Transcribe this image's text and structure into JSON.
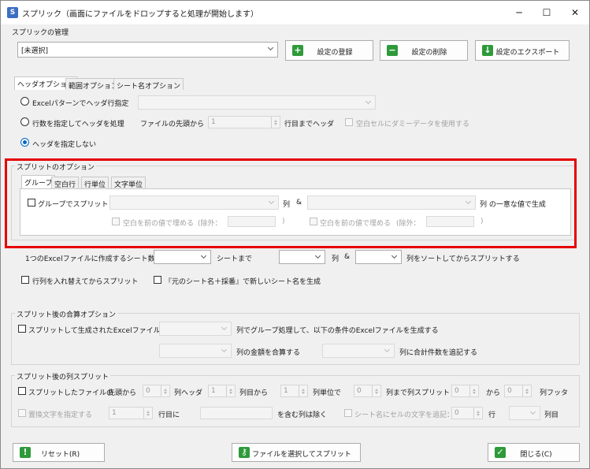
{
  "window": {
    "title": "スプリック（画面にファイルをドロップすると処理が開始します）",
    "minimize": "─",
    "maximize": "☐",
    "close": "✕"
  },
  "settings": {
    "section_label": "スプリックの管理",
    "selected": "[未選択]",
    "register_label": "設定の登録",
    "delete_label": "設定の削除",
    "export_label": "設定のエクスポート"
  },
  "header_tabs": [
    "ヘッダオプション",
    "範囲オプション",
    "シート名オプション"
  ],
  "header": {
    "radio1_label": "Excelパターンでヘッダ行指定",
    "radio2_label": "行数を指定してヘッダを処理",
    "from_top_label": "ファイルの先頭から",
    "rows_value": "1",
    "rows_suffix": "行目までヘッダ",
    "dummy_label": "空白セルにダミーデータを使用する",
    "radio3_label": "ヘッダを指定しない"
  },
  "split_options": {
    "section_label": "スプリットのオプション",
    "tabs": [
      "グループ",
      "空白行",
      "行単位",
      "文字単位"
    ],
    "group_split_label": "グループでスプリット",
    "col_label": "列",
    "amp": "&",
    "col_unique_label": "列 の一意な値で生成",
    "fill_label": "空白を前の値で埋める",
    "exclude_label": "(除外：",
    "paren_close": ")"
  },
  "sheets": {
    "count_label": "1つのExcelファイルに作成するシート数は",
    "until_label": "シートまで",
    "col_label": "列",
    "amp": "&",
    "sort_label": "列をソートしてからスプリットする",
    "swap_label": "行列を入れ替えてからスプリット",
    "newname_label": "『元のシート名＋採番』で新しいシート名を生成"
  },
  "merge": {
    "section_label": "スプリット後の合算オプション",
    "check_label": "スプリットして生成されたExcelファイルから",
    "group_label": "列でグループ処理して、以下の条件のExcelファイルを生成する",
    "sum_label": "列の金額を合算する",
    "count_label": "列に合計件数を追記する"
  },
  "colsplit": {
    "section_label": "スプリット後の列スプリット",
    "check_label": "スプリットしたファイルの",
    "from_label": "先頭から",
    "v1": "0",
    "header_label": "列ヘッダ",
    "v2": "1",
    "from_row_label": "列目から",
    "v3": "1",
    "unit_label": "列単位で",
    "v4": "0",
    "until_label": "列まで列スプリット",
    "v5": "0",
    "kara": "から",
    "v6": "0",
    "footer_label": "列フッタ",
    "replace_label": "置換文字を指定する",
    "v7": "1",
    "row_label": "行目に",
    "exclude_label": "を含む列は除く",
    "append_label": "シート名にセルの文字を追記：",
    "v8": "0",
    "gyo": "行",
    "col_suffix": "列目"
  },
  "footer": {
    "reset_label": "リセット(R)",
    "select_label": "ファイルを選択してスプリット",
    "close_label": "閉じる(C)"
  },
  "colors": {
    "highlight": "#e60000",
    "accent": "#0067c0"
  }
}
